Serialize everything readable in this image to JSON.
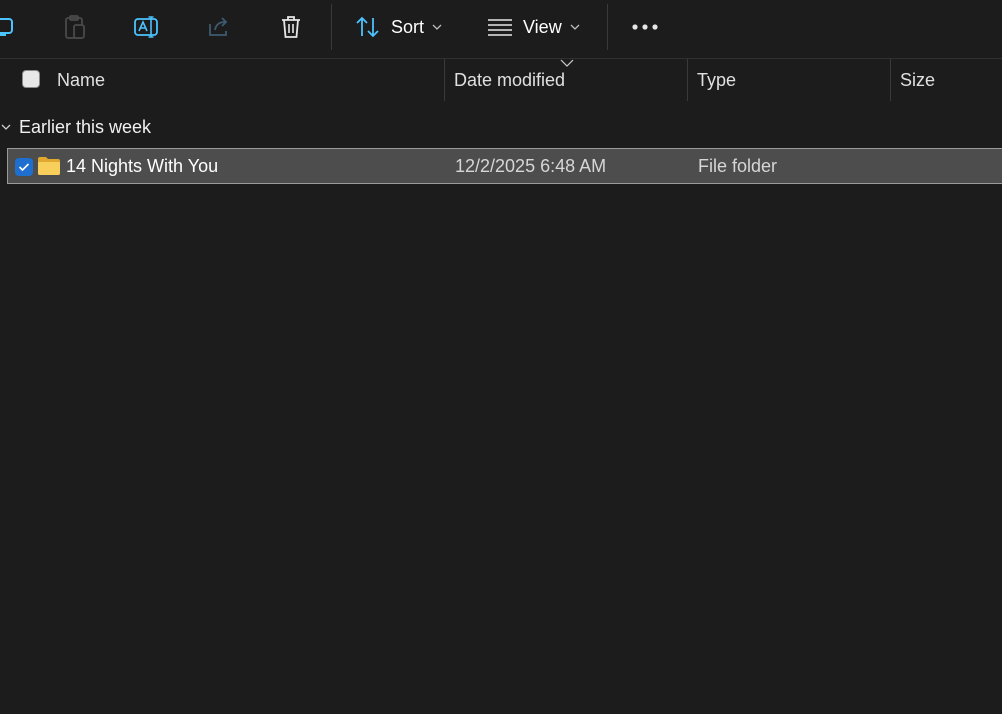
{
  "toolbar": {
    "sort_label": "Sort",
    "view_label": "View",
    "icons": [
      "copy-icon",
      "paste-icon",
      "rename-icon",
      "share-icon",
      "delete-icon",
      "sort-icon",
      "view-icon",
      "more-icon"
    ]
  },
  "columns": {
    "name": "Name",
    "date_modified": "Date modified",
    "type": "Type",
    "size": "Size"
  },
  "group": {
    "label": "Earlier this week"
  },
  "rows": [
    {
      "name": "14 Nights With You",
      "date_modified": "12/2/2025 6:48 AM",
      "type": "File folder",
      "size": "",
      "selected": true
    }
  ],
  "colors": {
    "accent": "#4cc2ff",
    "selection_bg": "#4d4d4d",
    "checkbox_checked": "#1f6fd1",
    "folder": "#f5c542"
  }
}
